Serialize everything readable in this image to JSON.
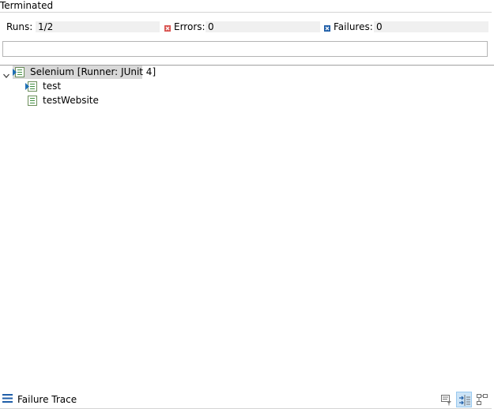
{
  "status": "Terminated",
  "counters": {
    "runs_label": "Runs:",
    "runs_value": "1/2",
    "errors_label": "Errors:",
    "errors_value": "0",
    "failures_label": "Failures:",
    "failures_value": "0"
  },
  "progress": {
    "fraction": 0
  },
  "tree": {
    "root": {
      "label": "Selenium [Runner: JUnit 4]",
      "expanded": true,
      "selected": true,
      "icon": "test-suite-running-icon"
    },
    "children": [
      {
        "label": "test",
        "icon": "test-running-icon"
      },
      {
        "label": "testWebsite",
        "icon": "test-icon"
      }
    ]
  },
  "footer": {
    "title": "Failure Trace",
    "buttons": [
      {
        "name": "filter-stack-trace-button",
        "icon": "filter-trace-icon",
        "active": false
      },
      {
        "name": "compare-result-button",
        "icon": "compare-icon",
        "active": true
      },
      {
        "name": "show-hierarchy-button",
        "icon": "hierarchy-icon",
        "active": false
      }
    ]
  },
  "colors": {
    "error_icon": "#d9534f",
    "failure_icon": "#1f5ea8",
    "selection": "#d9d9d9",
    "active_button": "#cce4f7"
  }
}
